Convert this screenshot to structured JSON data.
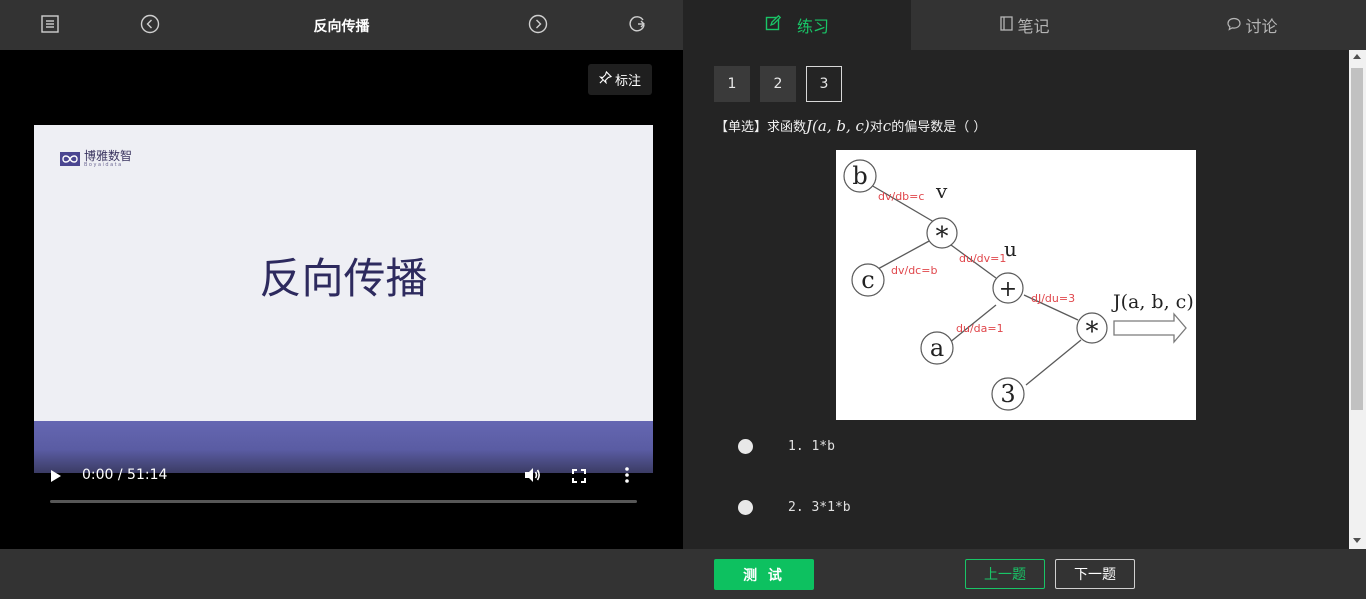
{
  "header": {
    "lesson_title": "反向传播",
    "icons": [
      "list-icon",
      "prev-circle-icon",
      "next-circle-icon",
      "refresh-icon"
    ]
  },
  "video": {
    "mark_label": "标注",
    "slide": {
      "logo_cn": "博雅数智",
      "logo_en": "Boyaidata",
      "title": "反向传播"
    },
    "time": "0:00 / 51:14",
    "progress": 0
  },
  "tabs": [
    {
      "label": "练习",
      "icon": "edit-icon",
      "active": true
    },
    {
      "label": "笔记",
      "icon": "notebook-icon",
      "active": false
    },
    {
      "label": "讨论",
      "icon": "chat-icon",
      "active": false
    }
  ],
  "question": {
    "numbers": [
      "1",
      "2",
      "3"
    ],
    "current": "3",
    "type_tag": "【单选】",
    "text_before": "求函数",
    "formula": "J(a, b, c)",
    "text_mid": "对",
    "var": "c",
    "text_after": "的偏导数是（ ）",
    "diagram": {
      "nodes": [
        "b",
        "c",
        "*",
        "+",
        "a",
        "*",
        "3"
      ],
      "node_labels": [
        "v",
        "u",
        "J(a, b, c)"
      ],
      "edge_labels": [
        "dv/db=c",
        "dv/dc=b",
        "du/dv=1",
        "du/da=1",
        "dJ/du=3"
      ]
    },
    "options": [
      {
        "label": "1. 1*b"
      },
      {
        "label": "2. 3*1*b"
      }
    ]
  },
  "footer": {
    "test_label": "测 试",
    "prev_label": "上一题",
    "next_label": "下一题"
  },
  "colors": {
    "accent": "#19c567",
    "test_button": "#0dc160",
    "panel": "#242424",
    "bar": "#333333",
    "edge_label": "#e0474c"
  }
}
